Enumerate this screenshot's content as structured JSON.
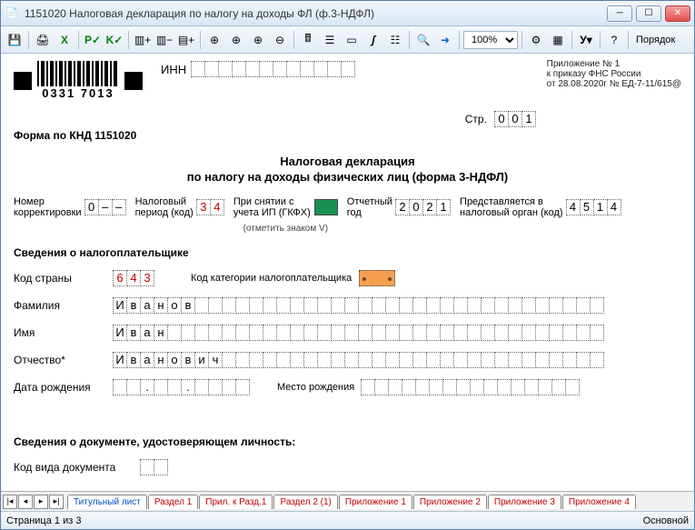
{
  "titlebar": {
    "icon": "document-icon",
    "text": "1151020  Налоговая декларация по налогу на доходы ФЛ (ф.3-НДФЛ)"
  },
  "toolbar": {
    "zoom": "100%",
    "order_label": "Порядок"
  },
  "doc": {
    "barcode_number": "0331 7013",
    "inn_label": "ИНН",
    "appendix": {
      "line1": "Приложение № 1",
      "line2": "к приказу ФНС России",
      "line3": "от 28.08.2020г № ЕД-7-11/615@"
    },
    "str_label": "Стр.",
    "str_value": [
      "0",
      "0",
      "1"
    ],
    "knd": "Форма по КНД 1151020",
    "title1": "Налоговая декларация",
    "title2": "по налогу на доходы физических лиц (форма 3-НДФЛ)",
    "fields": {
      "corr_label": "Номер\nкорректировки",
      "corr_val": [
        "0",
        "–",
        "–"
      ],
      "period_label": "Налоговый\nпериод (код)",
      "period_val": [
        "3",
        "4"
      ],
      "ip_label": "При снятии с\nучета ИП (ГКФХ)",
      "ip_note": "(отметить знаком V)",
      "year_label": "Отчетный\nгод",
      "year_val": [
        "2",
        "0",
        "2",
        "1"
      ],
      "organ_label": "Представляется в\nналоговый орган (код)",
      "organ_val": [
        "4",
        "5",
        "1",
        "4"
      ]
    },
    "section_taxpayer": "Сведения о налогоплательщике",
    "country_label": "Код страны",
    "country_val": [
      "6",
      "4",
      "3"
    ],
    "category_label": "Код категории налогоплательщика",
    "surname_label": "Фамилия",
    "surname_val": [
      "И",
      "в",
      "а",
      "н",
      "о",
      "в"
    ],
    "name_label": "Имя",
    "name_val": [
      "И",
      "в",
      "а",
      "н"
    ],
    "patronymic_label": "Отчество*",
    "patronymic_val": [
      "И",
      "в",
      "а",
      "н",
      "о",
      "в",
      "и",
      "ч"
    ],
    "birthdate_label": "Дата рождения",
    "birthplace_label": "Место рождения",
    "section_doc": "Сведения о документе, удостоверяющем личность:",
    "doctype_label": "Код вида документа"
  },
  "tabs": {
    "items": [
      {
        "label": "Титульный лист",
        "active": true
      },
      {
        "label": "Раздел 1"
      },
      {
        "label": "Прил. к Разд.1"
      },
      {
        "label": "Раздел 2 (1)"
      },
      {
        "label": "Приложение 1"
      },
      {
        "label": "Приложение 2"
      },
      {
        "label": "Приложение 3"
      },
      {
        "label": "Приложение 4"
      }
    ]
  },
  "statusbar": {
    "page": "Страница 1 из 3",
    "mode": "Основной"
  }
}
